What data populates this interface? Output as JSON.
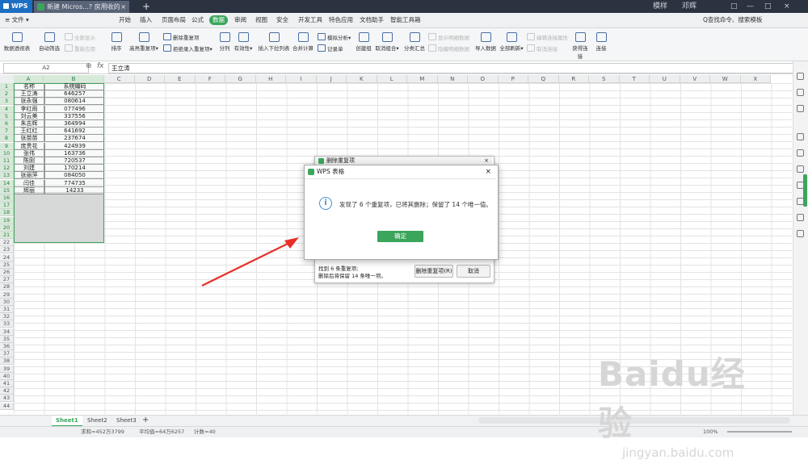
{
  "titlebar": {
    "app": "WPS",
    "tab_title": "新建 Micros...? 房用收的工作簿",
    "tab_close": "×",
    "add_tab": "+",
    "right_items": [
      "模样",
      "邓辉",
      "□",
      "—",
      "□",
      "×"
    ]
  },
  "menu": {
    "file": "≡ 文件 ▾",
    "items": [
      "开始",
      "插入",
      "页面布局",
      "公式",
      "数据",
      "审阅",
      "视图",
      "安全",
      "开发工具",
      "特色应用",
      "文档助手",
      "智能工具箱"
    ],
    "active": "数据",
    "search": "Q查找命令、搜索模板"
  },
  "ribbon": {
    "big": [
      "数据透视表",
      "自动筛选",
      "排序",
      "高亮重复项▾",
      "分列",
      "有效性▾",
      "插入下拉列表",
      "合并计算",
      "创建组",
      "取消组合▾",
      "分类汇总",
      "导入数据",
      "全部刷新▾",
      "取消连接",
      "获得连接",
      "连接"
    ],
    "small": {
      "show_all": "全部显示",
      "reapply": "重新应用",
      "delete_dup": "删除重复项",
      "reject_dup": "拒绝录入重复项▾",
      "sim_analysis": "模拟分析▾",
      "record": "记录单",
      "show_detail": "显示明细数据",
      "hide_detail": "隐藏明细数据",
      "edit_link": "编辑连接属性",
      "link_props": "编辑连接属性"
    }
  },
  "formula": {
    "namebox": "A2",
    "zoom_icon": "⊕",
    "fx": "fx",
    "value": "王立涛"
  },
  "grid": {
    "columns": [
      "A",
      "B",
      "C",
      "D",
      "E",
      "F",
      "G",
      "H",
      "I",
      "J",
      "K",
      "L",
      "M",
      "N",
      "O",
      "P",
      "Q",
      "R",
      "S",
      "T",
      "U",
      "V",
      "W",
      "X"
    ],
    "rows": [
      "1",
      "2",
      "3",
      "4",
      "5",
      "6",
      "7",
      "8",
      "9",
      "10",
      "11",
      "12",
      "13",
      "14",
      "15",
      "16",
      "17",
      "18",
      "19",
      "20",
      "21",
      "22",
      "23",
      "24",
      "25",
      "26",
      "27",
      "28",
      "29",
      "30",
      "31",
      "32",
      "33",
      "34",
      "35",
      "36",
      "37",
      "38",
      "39",
      "40",
      "41",
      "42",
      "43",
      "44"
    ],
    "header": [
      "名称",
      "系统编码"
    ],
    "data": [
      [
        "王立涛",
        "646257"
      ],
      [
        "张永强",
        "080614"
      ],
      [
        "李红雨",
        "077496"
      ],
      [
        "刘云美",
        "337556"
      ],
      [
        "朱志辉",
        "364994"
      ],
      [
        "王红红",
        "641692"
      ],
      [
        "张苗苗",
        "237674"
      ],
      [
        "庞贵花",
        "424939"
      ],
      [
        "张伟",
        "163736"
      ],
      [
        "陈刚",
        "720537"
      ],
      [
        "刘建",
        "170214"
      ],
      [
        "张丽萍",
        "084050"
      ],
      [
        "闫佳",
        "774735"
      ],
      [
        "辉丽",
        "14233"
      ]
    ]
  },
  "sheets": {
    "tabs": [
      "Sheet1",
      "Sheet2",
      "Sheet3"
    ],
    "active": "Sheet1",
    "add": "+"
  },
  "status": {
    "sum": "求和=452万3799",
    "avg": "平均值=64万6257",
    "count": "计数=40",
    "zoom": "100%"
  },
  "dialog_back": {
    "title": "删除重复项",
    "close": "×",
    "line1": "找到 6 条重复项;",
    "line2": "删除后将保留 14 条唯一项。",
    "delete_btn": "删除重复项(R)",
    "cancel_btn": "取消"
  },
  "dialog": {
    "title": "WPS 表格",
    "close": "×",
    "info_icon": "i",
    "message": "发现了 6 个重复项，已将其删除；保留了 14 个唯一值。",
    "ok": "确定"
  },
  "watermark": {
    "text": "Baidu经验",
    "sub": "jingyan.baidu.com"
  },
  "colors": {
    "accent": "#3ba55c",
    "arrow": "#e8302a",
    "titlebar": "#2b3340"
  }
}
